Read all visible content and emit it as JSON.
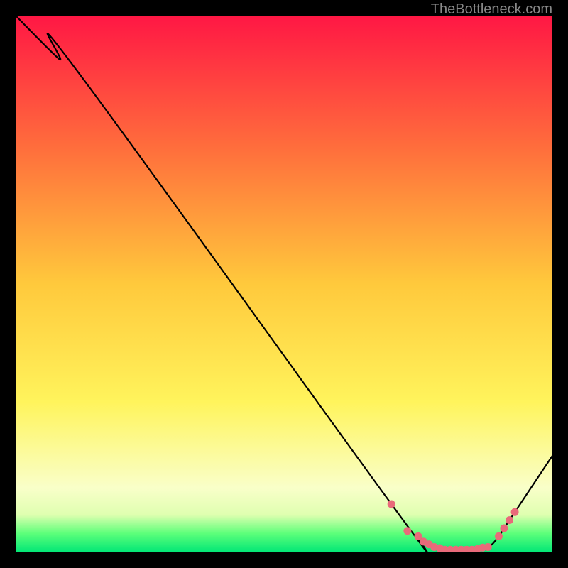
{
  "watermark": "TheBottleneck.com",
  "chart_data": {
    "type": "line",
    "title": "",
    "xlabel": "",
    "ylabel": "",
    "xlim": [
      0,
      100
    ],
    "ylim": [
      0,
      100
    ],
    "gradient_stops": [
      {
        "offset": 0,
        "color": "#ff1744"
      },
      {
        "offset": 25,
        "color": "#ff6f3c"
      },
      {
        "offset": 50,
        "color": "#ffc93c"
      },
      {
        "offset": 72,
        "color": "#fff45c"
      },
      {
        "offset": 88,
        "color": "#f9ffc9"
      },
      {
        "offset": 93,
        "color": "#dfffb0"
      },
      {
        "offset": 96.5,
        "color": "#5cff7a"
      },
      {
        "offset": 100,
        "color": "#00e676"
      }
    ],
    "series": [
      {
        "name": "bottleneck-curve",
        "x": [
          0,
          8,
          12,
          70,
          75,
          78,
          80,
          85,
          88,
          90,
          92,
          100
        ],
        "y": [
          100,
          92,
          89,
          9,
          3,
          1,
          0.5,
          0.5,
          1,
          3,
          6,
          18
        ]
      }
    ],
    "markers": {
      "name": "highlight-points",
      "color": "#e96a7a",
      "x": [
        70,
        73,
        75,
        76,
        77,
        78,
        79,
        80,
        81,
        82,
        83,
        84,
        85,
        86,
        87,
        88,
        90,
        91,
        92,
        93
      ],
      "y": [
        9,
        4,
        3,
        2,
        1.5,
        1,
        0.8,
        0.5,
        0.5,
        0.5,
        0.5,
        0.5,
        0.5,
        0.6,
        0.9,
        1,
        3,
        4.5,
        6,
        7.5
      ]
    }
  }
}
